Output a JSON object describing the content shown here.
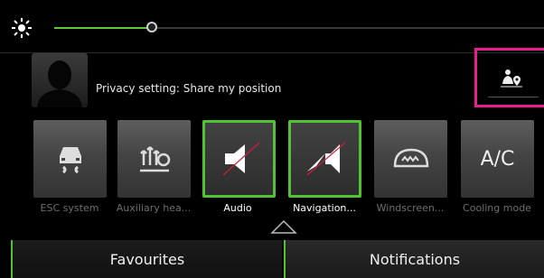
{
  "brightness": {
    "level": 0.2
  },
  "profile": {
    "privacy_text": "Privacy setting: Share my position"
  },
  "share_position": {
    "icon": "person-location-icon",
    "highlight_color": "#e81e8c"
  },
  "quick_access": [
    {
      "label": "ESC system",
      "icon": "esc-car-icon",
      "active": false
    },
    {
      "label": "Auxiliary hea...",
      "icon": "auxiliary-heating-icon",
      "active": false
    },
    {
      "label": "Audio",
      "icon": "speaker-muted-icon",
      "active": true
    },
    {
      "label": "Navigation...",
      "icon": "navigation-muted-icon",
      "active": true
    },
    {
      "label": "Windscreen...",
      "icon": "windscreen-heating-icon",
      "active": false
    },
    {
      "label": "Cooling mode",
      "icon": "ac-icon",
      "active": false,
      "text": "A/C"
    }
  ],
  "tabs": {
    "favourites": "Favourites",
    "notifications": "Notifications"
  },
  "colors": {
    "accent": "#52c234",
    "muted_slash": "#d21d3a"
  }
}
